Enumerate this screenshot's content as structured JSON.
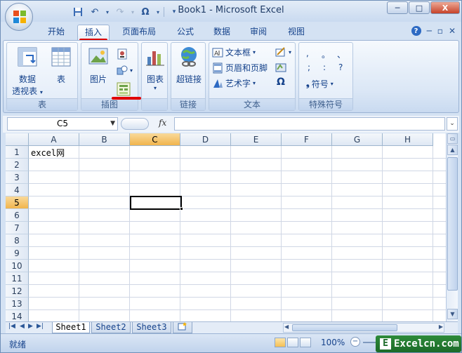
{
  "window": {
    "title": "Book1 - Microsoft Excel",
    "controls": {
      "minimize": "─",
      "maximize": "□",
      "close": "X"
    }
  },
  "quick_access": {
    "omega": "Ω"
  },
  "tabs": [
    {
      "label": "开始",
      "active": false
    },
    {
      "label": "插入",
      "active": true
    },
    {
      "label": "页面布局",
      "active": false
    },
    {
      "label": "公式",
      "active": false
    },
    {
      "label": "数据",
      "active": false
    },
    {
      "label": "审阅",
      "active": false
    },
    {
      "label": "视图",
      "active": false
    }
  ],
  "ribbon": {
    "tables_group": {
      "label": "表",
      "pivot_line1": "数据",
      "pivot_line2": "透视表",
      "table": "表"
    },
    "illustrations_group": {
      "label": "插图",
      "picture": "图片"
    },
    "charts_group": {
      "chart": "图表"
    },
    "links_group": {
      "label": "链接",
      "hyperlink": "超链接"
    },
    "text_group": {
      "label": "文本",
      "textbox": "文本框",
      "header_footer": "页眉和页脚",
      "wordart": "艺术字",
      "omega": "Ω"
    },
    "symbols_group": {
      "label": "特殊符号",
      "row1": [
        ",",
        "。",
        "、"
      ],
      "row2": [
        ";",
        ":",
        "?"
      ],
      "symbol": "符号"
    }
  },
  "formula_bar": {
    "name_box": "C5",
    "fx": "fx",
    "content": ""
  },
  "grid": {
    "columns": [
      "A",
      "B",
      "C",
      "D",
      "E",
      "F",
      "G",
      "H"
    ],
    "rows": [
      "1",
      "2",
      "3",
      "4",
      "5",
      "6",
      "7",
      "8",
      "9",
      "10",
      "11",
      "12",
      "13",
      "14"
    ],
    "selected_column": "C",
    "selected_row": "5",
    "cells": {
      "A1": "excel网"
    }
  },
  "sheets": [
    {
      "name": "Sheet1",
      "active": true
    },
    {
      "name": "Sheet2",
      "active": false
    },
    {
      "name": "Sheet3",
      "active": false
    }
  ],
  "status_bar": {
    "status": "就绪",
    "zoom": "100%",
    "zoom_minus": "−"
  },
  "watermark": {
    "e": "E",
    "text": "Excelcn.com"
  },
  "colors": {
    "accent": "#15428b",
    "selected_header": "#f1b54d",
    "annotation_red": "#e00000"
  }
}
